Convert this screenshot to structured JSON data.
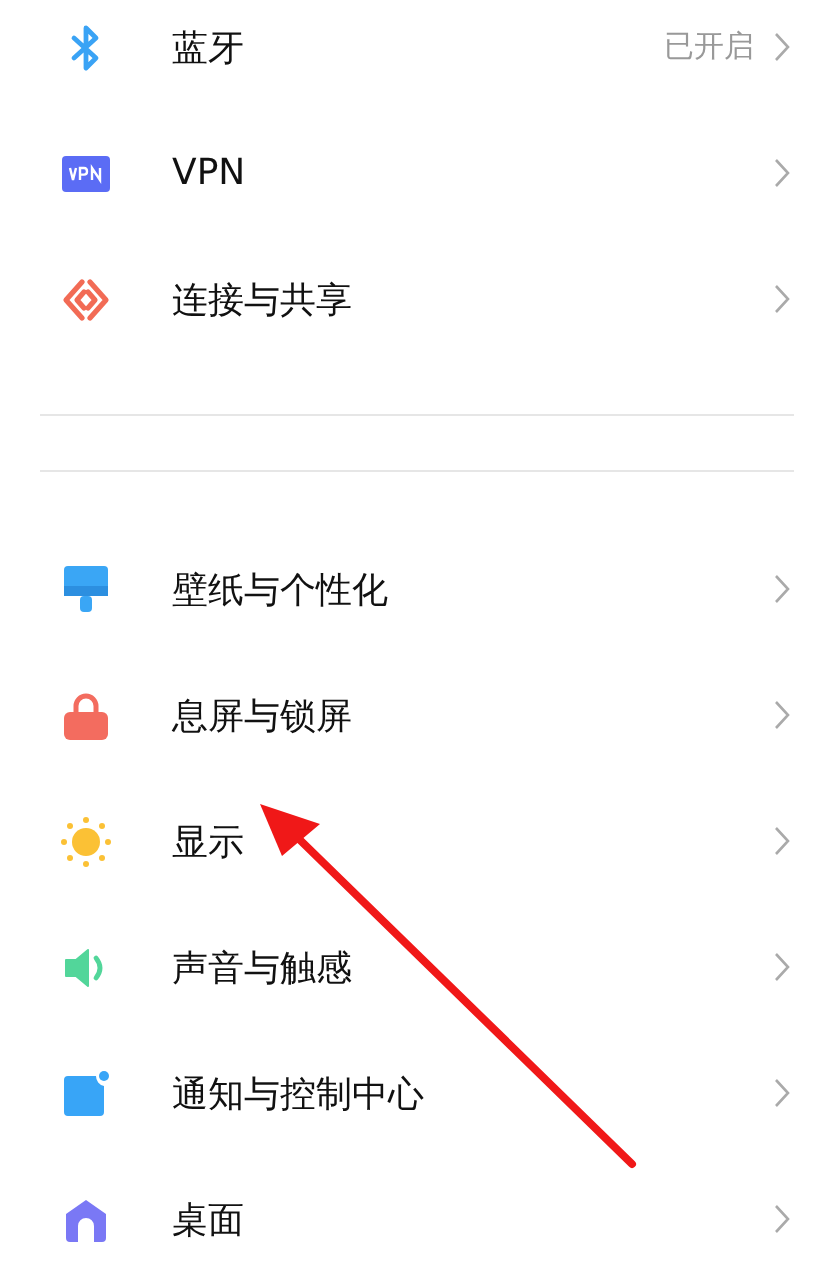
{
  "groups": [
    {
      "items": [
        {
          "label": "蓝牙",
          "value": "已开启"
        },
        {
          "label": "VPN"
        },
        {
          "label": "连接与共享"
        }
      ]
    },
    {
      "items": [
        {
          "label": "壁纸与个性化"
        },
        {
          "label": "息屏与锁屏"
        },
        {
          "label": "显示"
        },
        {
          "label": "声音与触感"
        },
        {
          "label": "通知与控制中心"
        },
        {
          "label": "桌面"
        }
      ]
    }
  ]
}
